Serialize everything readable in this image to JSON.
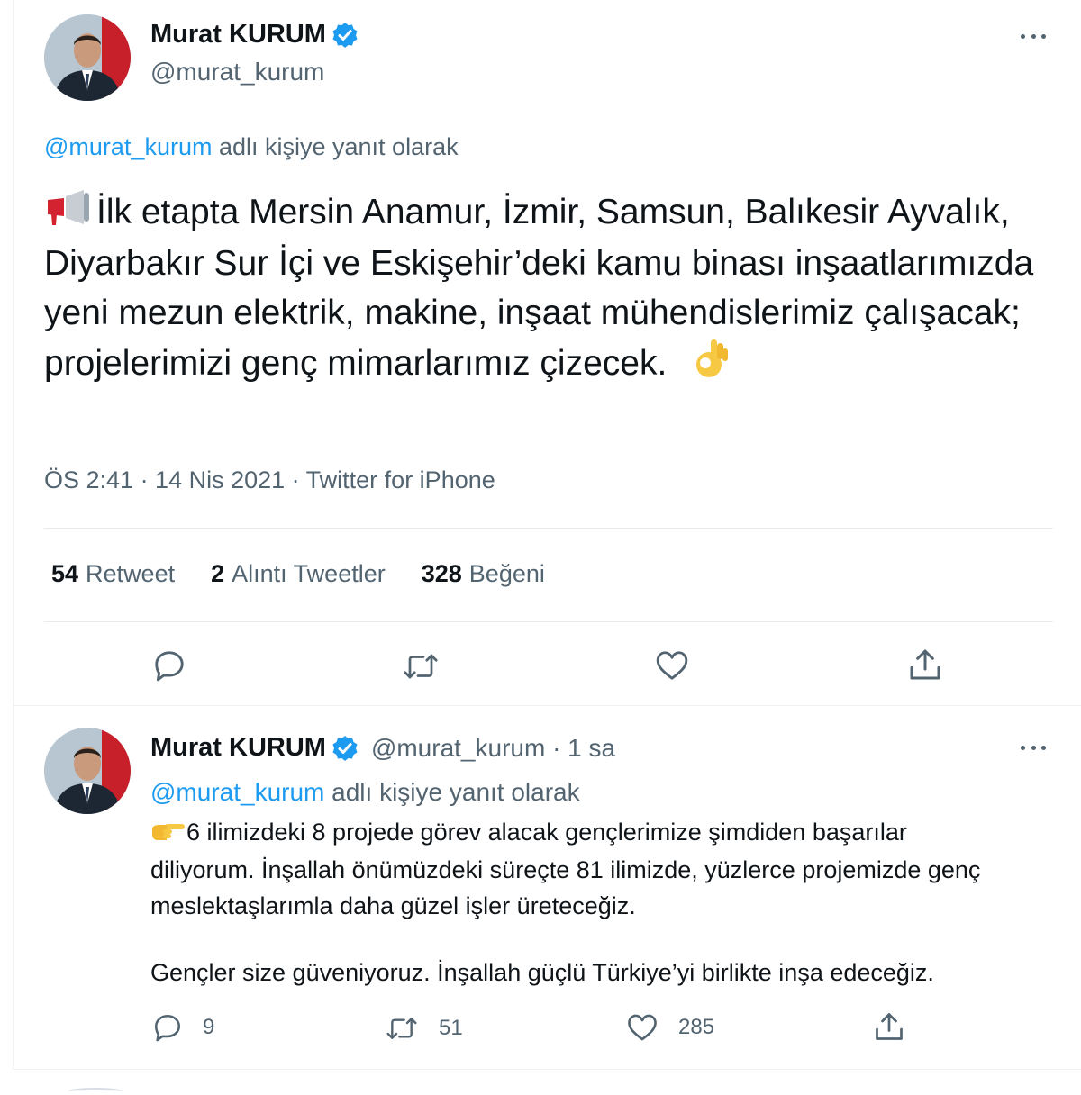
{
  "main_tweet": {
    "author": {
      "name": "Murat KURUM",
      "handle": "@murat_kurum"
    },
    "replying_to": {
      "handle": "@murat_kurum",
      "suffix": " adlı kişiye yanıt olarak"
    },
    "text": "İlk etapta Mersin Anamur, İzmir, Samsun, Balıkesir Ayvalık, Diyarbakır Sur İçi ve Eskişehir’deki kamu binası inşaatlarımızda yeni mezun elektrik, makine, inşaat mühendislerimiz çalışacak; projelerimizi genç mimarlarımız çizecek.",
    "leading_emoji": "megaphone-icon",
    "trailing_emoji": "ok-hand-icon",
    "meta": "ÖS 2:41 · 14 Nis 2021 · Twitter for iPhone",
    "stats": {
      "retweets": {
        "count": "54",
        "label": "Retweet"
      },
      "quotes": {
        "count": "2",
        "label": "Alıntı Tweetler"
      },
      "likes": {
        "count": "328",
        "label": "Beğeni"
      }
    }
  },
  "reply_tweet": {
    "author": {
      "name": "Murat KURUM",
      "handle_time": "@murat_kurum · 1 sa"
    },
    "replying_to": {
      "handle": "@murat_kurum",
      "suffix": " adlı kişiye yanıt olarak"
    },
    "leading_emoji": "pointing-hand-icon",
    "paragraph_1": "6 ilimizdeki 8 projede görev alacak gençlerimize şimdiden başarılar diliyorum. İnşallah önümüzdeki süreçte 81 ilimizde, yüzlerce projemizde genç meslektaşlarımla daha güzel işler üreteceğiz.",
    "paragraph_2": "Gençler size güveniyoruz. İnşallah güçlü Türkiye’yi birlikte inşa edeceğiz.",
    "counts": {
      "replies": "9",
      "retweets": "51",
      "likes": "285"
    }
  },
  "colors": {
    "accent": "#1d9bf0",
    "text": "#0f1419",
    "muted": "#536471",
    "divider": "#eff3f4"
  }
}
